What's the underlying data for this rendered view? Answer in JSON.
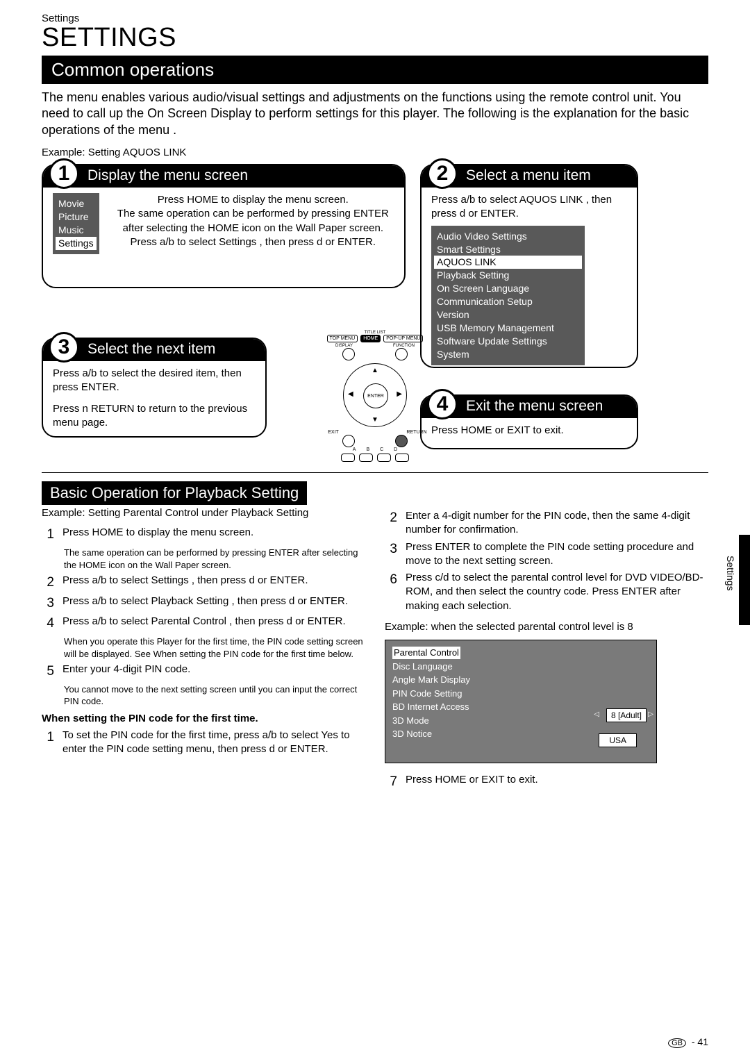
{
  "header": {
    "breadcrumb": "Settings",
    "title": "SETTINGS",
    "section_bar": "Common operations",
    "intro": "The  menu  enables various audio/visual settings and adjustments on the functions using the remote control unit. You need to call up the On Screen Display to perform settings for this player. The following is the explanation for the basic operations of the  menu .",
    "example": "Example: Setting  AQUOS LINK"
  },
  "box1": {
    "title": "Display the menu screen",
    "menu": [
      "Movie",
      "Picture",
      "Music",
      "Settings"
    ],
    "menu_selected_index": 3,
    "text": "Press HOME to display the menu screen.\nThe same operation can be performed by pressing ENTER after selecting the HOME icon on the Wall Paper screen.\nPress a/b to select  Settings , then press d or ENTER."
  },
  "box2": {
    "title": "Select a menu item",
    "text": "Press a/b to select  AQUOS LINK , then press d or ENTER.",
    "menu": [
      "Audio Video Settings",
      "Smart Settings",
      "AQUOS LINK",
      "Playback Setting",
      "On Screen Language",
      "Communication Setup",
      "Version",
      "USB Memory Management",
      "Software Update Settings",
      "System"
    ],
    "menu_selected_index": 2
  },
  "box3": {
    "title": "Select the next item",
    "text1": "Press a/b to select the desired item, then press ENTER.",
    "text2": "Press n RETURN to return to the previous  menu  page."
  },
  "box4": {
    "title": "Exit the menu screen",
    "text": "Press HOME or EXIT to exit."
  },
  "remote": {
    "toprow": [
      "TITLE LIST",
      "",
      ""
    ],
    "row2": [
      "TOP MENU",
      "HOME",
      "POP-UP MENU"
    ],
    "row3": [
      "DISPLAY",
      "",
      "FUNCTION"
    ],
    "enter": "ENTER",
    "labels": {
      "exit": "EXIT",
      "return": "RETURN"
    },
    "letters": [
      "A",
      "B",
      "C",
      "D"
    ]
  },
  "basic": {
    "bar": "Basic Operation for Playback Setting",
    "example": "Example: Setting  Parental Control  under  Playback Setting",
    "left": [
      {
        "n": "1",
        "t": "Press HOME to display the menu screen.",
        "sub": "The same operation can be performed by pressing ENTER after selecting the HOME icon on the Wall Paper screen."
      },
      {
        "n": "2",
        "t": "Press a/b to select  Settings , then press d or ENTER."
      },
      {
        "n": "3",
        "t": "Press a/b to select  Playback Setting , then press d or ENTER."
      },
      {
        "n": "4",
        "t": "Press a/b to select  Parental Control , then press d or ENTER.",
        "sub": "When you operate this Player for the first time, the PIN code setting screen will be displayed. See  When setting the PIN code for the first time  below."
      },
      {
        "n": "5",
        "t": "Enter your 4-digit PIN code.",
        "sub": "You cannot move to the next setting screen until you can input the correct PIN code."
      }
    ],
    "pin_heading": "When setting the PIN code for the first time.",
    "pin_steps": [
      {
        "n": "1",
        "t": "To set the PIN code for the first time, press a/b to select  Yes  to enter the PIN code setting menu, then press d or ENTER."
      }
    ],
    "right": [
      {
        "n": "2",
        "t": "Enter a 4-digit number for the PIN code, then the same 4-digit number for confirmation."
      },
      {
        "n": "3",
        "t": "Press ENTER to complete the PIN code setting procedure and move to the next setting screen."
      },
      {
        "n": "6",
        "t": "Press c/d to select the parental control level for DVD VIDEO/BD-ROM, and then select the country code. Press ENTER after making each selection."
      }
    ],
    "right_example": "Example: when the selected parental control level is  8",
    "parental_menu": [
      "Parental Control",
      "Disc Language",
      "Angle Mark Display",
      "PIN Code Setting",
      "BD Internet Access",
      "3D Mode",
      "3D Notice"
    ],
    "parental_selected_index": 0,
    "parental_value": "8 [Adult]",
    "parental_country": "USA",
    "right_last": {
      "n": "7",
      "t": "Press HOME or EXIT to exit."
    }
  },
  "side_label": "Settings",
  "footer": {
    "region": "GB",
    "sep": "-",
    "page": "41"
  }
}
